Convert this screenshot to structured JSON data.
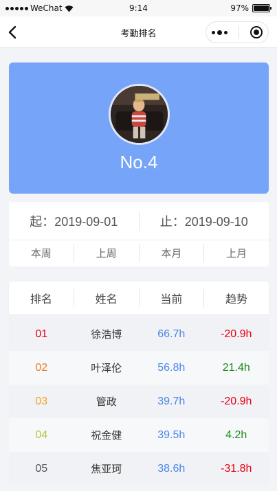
{
  "status_bar": {
    "carrier": "WeChat",
    "time": "9:14",
    "battery": "97%"
  },
  "nav": {
    "title": "考勤排名"
  },
  "hero": {
    "rank": "No.4"
  },
  "date_range": {
    "start": "起：2019-09-01",
    "end": "止：2019-09-10"
  },
  "periods": [
    "本周",
    "上周",
    "本月",
    "上月"
  ],
  "table": {
    "headers": [
      "排名",
      "姓名",
      "当前",
      "趋势"
    ],
    "rows": [
      {
        "rank": "01",
        "name": "徐浩博",
        "current": "66.7h",
        "trend": "-20.9h",
        "rank_color": "#e60012",
        "trend_color": "#e60012"
      },
      {
        "rank": "02",
        "name": "叶泽伦",
        "current": "56.8h",
        "trend": "21.4h",
        "rank_color": "#f07b1d",
        "trend_color": "#1a8a1a"
      },
      {
        "rank": "03",
        "name": "管政",
        "current": "39.7h",
        "trend": "-20.9h",
        "rank_color": "#f4a321",
        "trend_color": "#e60012"
      },
      {
        "rank": "04",
        "name": "祝金健",
        "current": "39.5h",
        "trend": "4.2h",
        "rank_color": "#b5c43a",
        "trend_color": "#1a8a1a"
      },
      {
        "rank": "05",
        "name": "焦亚珂",
        "current": "38.6h",
        "trend": "-31.8h",
        "rank_color": "#555555",
        "trend_color": "#e60012"
      }
    ]
  },
  "colors": {
    "hero_bg": "#76a4f9",
    "current": "#4a86e8"
  }
}
